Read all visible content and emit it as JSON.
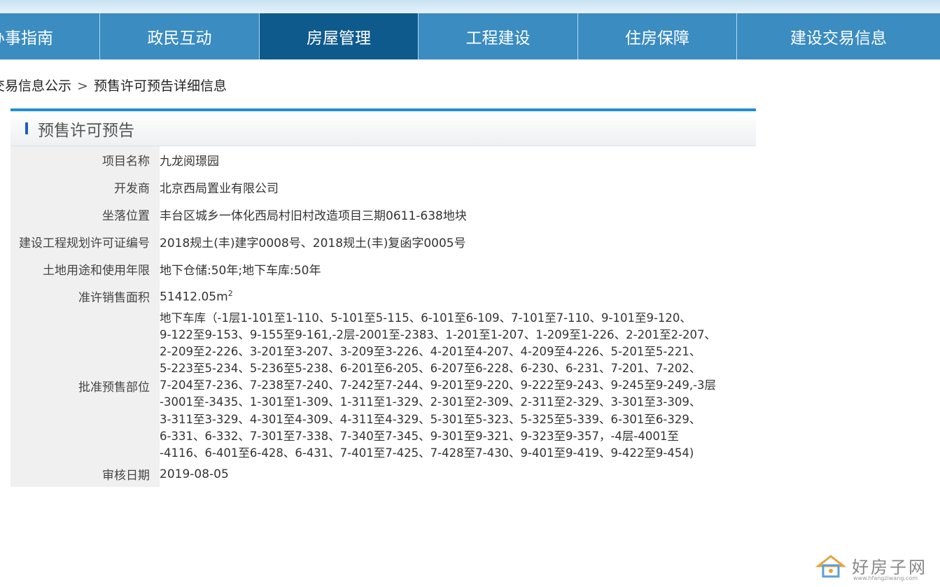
{
  "nav": {
    "items": [
      {
        "label": "办事指南"
      },
      {
        "label": "政民互动"
      },
      {
        "label": "房屋管理"
      },
      {
        "label": "工程建设"
      },
      {
        "label": "住房保障"
      },
      {
        "label": "建设交易信息"
      }
    ],
    "active_index": 2
  },
  "breadcrumb": {
    "parent": "交易信息公示",
    "separator": ">",
    "current": "预售许可预告详细信息"
  },
  "panel": {
    "title": "预售许可预告",
    "rows": [
      {
        "label": "项目名称",
        "value": "九龙阅璟园"
      },
      {
        "label": "开发商",
        "value": "北京西局置业有限公司"
      },
      {
        "label": "坐落位置",
        "value": "丰台区城乡一体化西局村旧村改造项目三期0611-638地块"
      },
      {
        "label": "建设工程规划许可证编号",
        "value": "2018规土(丰)建字0008号、2018规土(丰)复函字0005号"
      },
      {
        "label": "土地用途和使用年限",
        "value": "地下仓储:50年;地下车库:50年"
      },
      {
        "label": "准许销售面积",
        "value": "51412.05m",
        "unit_sup": "2"
      },
      {
        "label": "批准预售部位",
        "value_lines": [
          "地下车库（-1层1-101至1-110、5-101至5-115、6-101至6-109、7-101至7-110、9-101至9-120、",
          "9-122至9-153、9-155至9-161,-2层-2001至-2383、1-201至1-207、1-209至1-226、2-201至2-207、",
          "2-209至2-226、3-201至3-207、3-209至3-226、4-201至4-207、4-209至4-226、5-201至5-221、",
          "5-223至5-234、5-236至5-238、6-201至6-205、6-207至6-228、6-230、6-231、7-201、7-202、",
          "7-204至7-236、7-238至7-240、7-242至7-244、9-201至9-220、9-222至9-243、9-245至9-249,-3层",
          "-3001至-3435、1-301至1-309、1-311至1-329、2-301至2-309、2-311至2-329、3-301至3-309、",
          "3-311至3-329、4-301至4-309、4-311至4-329、5-301至5-323、5-325至5-339、6-301至6-329、",
          "6-331、6-332、7-301至7-338、7-340至7-345、9-301至9-321、9-323至9-357，-4层-4001至",
          "-4116、6-401至6-428、6-431、7-401至7-425、7-428至7-430、9-401至9-419、9-422至9-454)"
        ]
      },
      {
        "label": "审核日期",
        "value": "2019-08-05"
      }
    ]
  },
  "watermark": {
    "text": "好房子网",
    "sub": "www.hfangziwang.com",
    "icon": "house-logo-icon"
  },
  "colors": {
    "nav_bg": "#3a8cc1",
    "nav_active": "#0f5a8c",
    "accent": "#1e8fd6"
  }
}
